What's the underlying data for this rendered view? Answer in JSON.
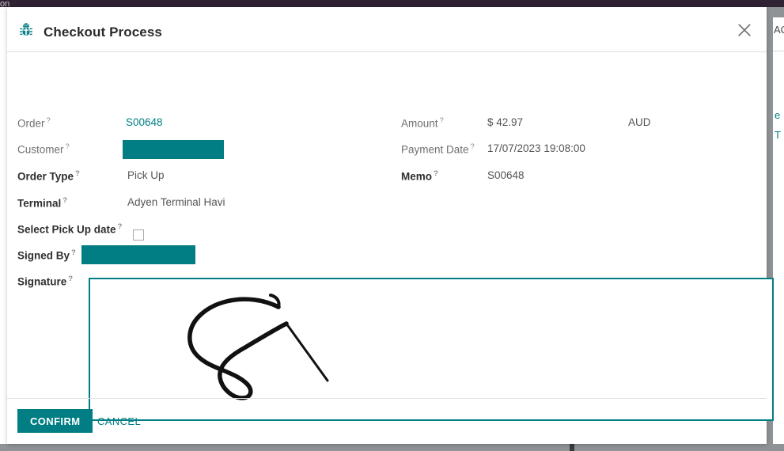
{
  "background": {
    "fragment_top_left": "on",
    "fragment_right_ac": "AC",
    "fragment_right_e": "e",
    "fragment_right_t": "T"
  },
  "modal": {
    "title": "Checkout Process",
    "icon": "bug-icon",
    "close_icon": "close-icon",
    "left_column": [
      {
        "label": "Order",
        "help": "?",
        "value": "S00648",
        "style": "light",
        "value_kind": "link"
      },
      {
        "label": "Customer",
        "help": "?",
        "value": "",
        "style": "light",
        "value_kind": "redacted"
      },
      {
        "label": "Order Type",
        "help": "?",
        "value": "Pick Up",
        "style": "bold",
        "value_kind": "text"
      },
      {
        "label": "Terminal",
        "help": "?",
        "value": "Adyen Terminal Havi",
        "style": "bold",
        "value_kind": "text"
      },
      {
        "label": "Select Pick Up date",
        "help": "?",
        "value": "",
        "style": "bold",
        "value_kind": "checkbox",
        "checked": false
      },
      {
        "label": "Signed By",
        "help": "?",
        "value": "",
        "style": "bold",
        "value_kind": "redacted"
      },
      {
        "label": "Signature",
        "help": "?",
        "value": "",
        "style": "bold",
        "value_kind": "signature"
      }
    ],
    "right_column": [
      {
        "label": "Amount",
        "help": "?",
        "value": "$ 42.97",
        "style": "light",
        "suffix": "AUD"
      },
      {
        "label": "Payment Date",
        "help": "?",
        "value": "17/07/2023 19:08:00",
        "style": "light",
        "suffix": ""
      },
      {
        "label": "Memo",
        "help": "?",
        "value": "S00648",
        "style": "bold",
        "suffix": ""
      }
    ],
    "footer": {
      "confirm_label": "CONFIRM",
      "cancel_label": "CANCEL"
    }
  },
  "colors": {
    "accent_teal": "#017e84",
    "topbar": "#2f2233",
    "label_bold": "#2f2f2f",
    "label_light": "#6f6f6f",
    "value_text": "#555555"
  }
}
